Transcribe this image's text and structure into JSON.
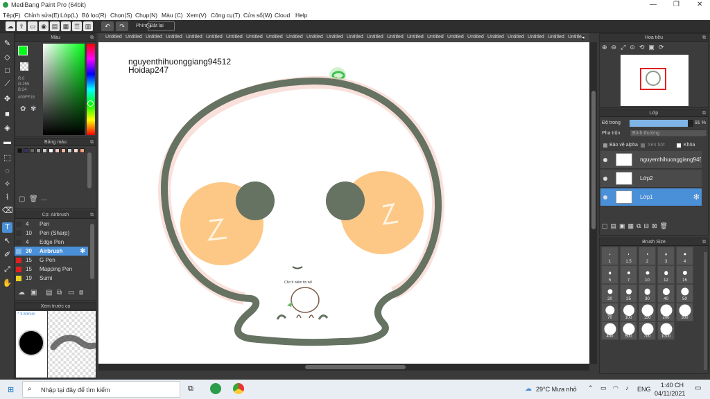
{
  "window": {
    "title": "MediBang Paint Pro (64bit)",
    "controls": [
      "—",
      "❐",
      "✕"
    ]
  },
  "menu": [
    "Tệp(F)",
    "Chỉnh sửa(E)",
    "Lớp(L)",
    "Bộ lọc(R)",
    "Chọn(S)",
    "Chụp(N)",
    "Màu (C)",
    "Xem(V)",
    "Công cụ(T)",
    "Cửa sổ(W)",
    "Cloud",
    "Help"
  ],
  "toolbar": {
    "phim_label": "Phím",
    "reset_label": "Đặt lại"
  },
  "color_panel": {
    "title": "Màu",
    "r": "R:0",
    "g": "G:255",
    "b": "B:24",
    "hex": "#00FF18",
    "current_color": "#00ff18"
  },
  "palette_panel": {
    "title": "Bảng màu",
    "footer": "----",
    "colors": [
      "#111111",
      "#333366",
      "#666666",
      "#999999",
      "#cccccc",
      "#ffffff",
      "#f4c6c6",
      "#f7b7a3",
      "#cfcfcf",
      "#ffd9cf",
      "#f0a080"
    ]
  },
  "brush_panel": {
    "title": "Cọ: Airbrush",
    "items": [
      {
        "num": "4",
        "name": "Pen",
        "color": "#333333"
      },
      {
        "num": "10",
        "name": "Pen (Sharp)",
        "color": "#333333"
      },
      {
        "num": "4",
        "name": "Edge Pen",
        "color": "#333333"
      },
      {
        "num": "30",
        "name": "Airbrush",
        "color": "#7fb4e6",
        "selected": true
      },
      {
        "num": "15",
        "name": "G Pen",
        "color": "#e02020"
      },
      {
        "num": "15",
        "name": "Mapping Pen",
        "color": "#e02020"
      },
      {
        "num": "19",
        "name": "Sumi",
        "color": "#e8d020"
      }
    ]
  },
  "preview_panel": {
    "title": "Xem trước cọ",
    "size": "* 3.63mm"
  },
  "tabs": {
    "label": "Untitled",
    "count": 24
  },
  "canvas": {
    "text_line1": "nguyenthihuonggiang94512",
    "text_line2": "Hoidap247",
    "small_caption": "Cho tí niềm tin nè!"
  },
  "navigator": {
    "title": "Hoa tiêu"
  },
  "layer_panel": {
    "title": "Lớp",
    "opacity_label": "Độ trong",
    "opacity_value": "91 %",
    "opacity": 0.91,
    "blend_label": "Pha trộn",
    "blend_value": "Bình thường",
    "alpha_protect": "Bảo vệ alpha",
    "clip": "Xén bớt",
    "lock": "Khóa",
    "layers": [
      {
        "name": "nguyenthihuonggiang94512",
        "selected": false
      },
      {
        "name": "Lớp2",
        "selected": false
      },
      {
        "name": "Lớp1",
        "selected": true
      }
    ]
  },
  "brush_size_panel": {
    "title": "Brush Size",
    "sizes": [
      "1",
      "1.5",
      "2",
      "3",
      "4",
      "5",
      "7",
      "10",
      "12",
      "15",
      "20",
      "25",
      "30",
      "40",
      "50",
      "70",
      "100",
      "150",
      "200",
      "300",
      "400",
      "500",
      "700",
      "1000"
    ]
  },
  "taskbar": {
    "search_placeholder": "Nhập tại đây để tìm kiếm",
    "weather": "29°C  Mưa nhỏ",
    "lang": "ENG",
    "time": "1:40 CH",
    "date": "04/11/2021"
  }
}
